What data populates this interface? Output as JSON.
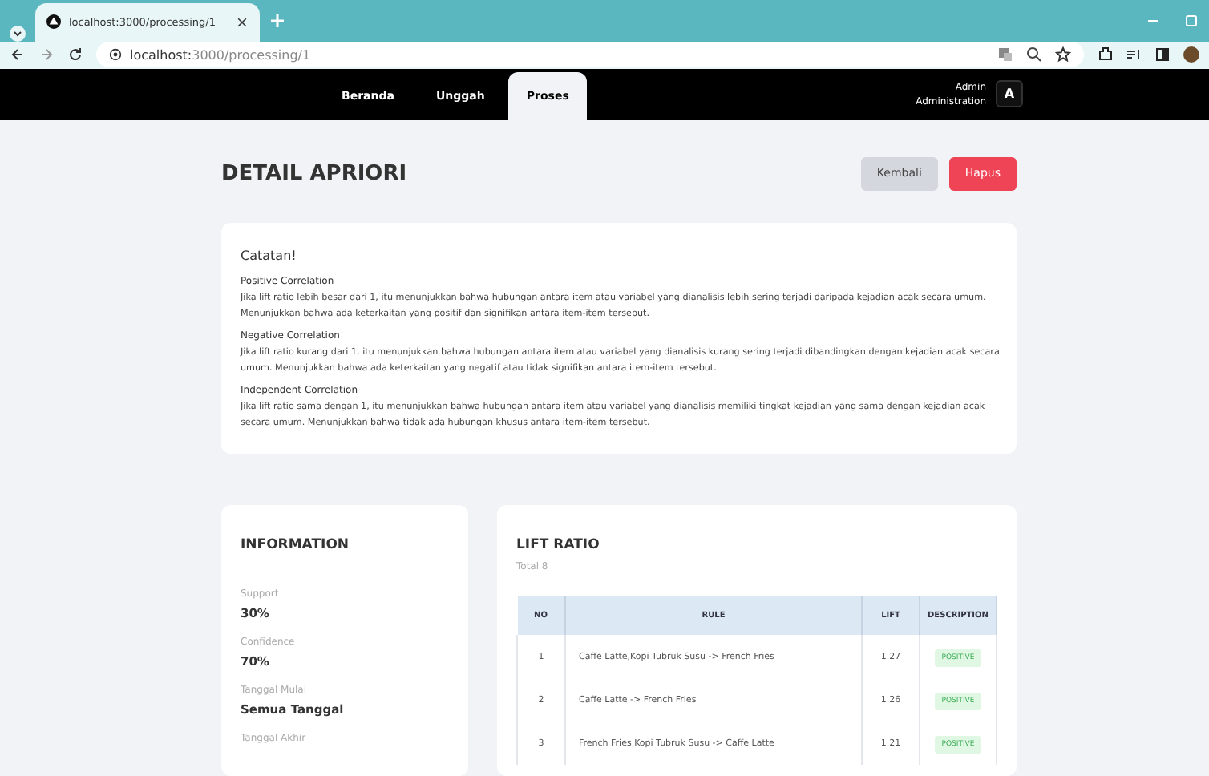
{
  "browser": {
    "tab_title": "localhost:3000/processing/1",
    "url_host": "localhost:",
    "url_path": "3000/processing/1"
  },
  "nav": {
    "items": [
      {
        "label": "Beranda",
        "selected": false
      },
      {
        "label": "Unggah",
        "selected": false
      },
      {
        "label": "Proses",
        "selected": true
      }
    ],
    "user_name": "Admin",
    "user_role": "Administration",
    "avatar": "A"
  },
  "page_title": "DETAIL APRIORI",
  "buttons": [
    {
      "label": "Kembali",
      "kind": "secondary"
    },
    {
      "label": "Hapus",
      "kind": "danger"
    }
  ],
  "notes": {
    "title": "Catatan!",
    "sections": [
      {
        "heading": "Positive Correlation",
        "text": "Jika lift ratio lebih besar dari 1, itu menunjukkan bahwa hubungan antara item atau variabel yang dianalisis lebih sering terjadi daripada kejadian acak secara umum. Menunjukkan bahwa ada keterkaitan yang positif dan signifikan antara item-item tersebut."
      },
      {
        "heading": "Negative Correlation",
        "text": "Jika lift ratio kurang dari 1, itu menunjukkan bahwa hubungan antara item atau variabel yang dianalisis kurang sering terjadi dibandingkan dengan kejadian acak secara umum. Menunjukkan bahwa ada keterkaitan yang negatif atau tidak signifikan antara item-item tersebut."
      },
      {
        "heading": "Independent Correlation",
        "text": "Jika lift ratio sama dengan 1, itu menunjukkan bahwa hubungan antara item atau variabel yang dianalisis memiliki tingkat kejadian yang sama dengan kejadian acak secara umum. Menunjukkan bahwa tidak ada hubungan khusus antara item-item tersebut."
      }
    ]
  },
  "information": {
    "title": "INFORMATION",
    "fields": [
      {
        "label": "Support",
        "value": "30%"
      },
      {
        "label": "Confidence",
        "value": "70%"
      },
      {
        "label": "Tanggal Mulai",
        "value": "Semua Tanggal"
      },
      {
        "label": "Tanggal Akhir"
      }
    ]
  },
  "lift_ratio": {
    "title": "LIFT RATIO",
    "total": "Total 8",
    "columns": [
      "NO",
      "RULE",
      "LIFT",
      "DESCRIPTION"
    ],
    "rows": [
      {
        "no": "1",
        "rule": "Caffe Latte,Kopi Tubruk Susu -> French Fries",
        "lift": "1.27",
        "description": "POSITIVE"
      },
      {
        "no": "2",
        "rule": "Caffe Latte -> French Fries",
        "lift": "1.26",
        "description": "POSITIVE"
      },
      {
        "no": "3",
        "rule": "French Fries,Kopi Tubruk Susu -> Caffe Latte",
        "lift": "1.21",
        "description": "POSITIVE"
      }
    ]
  }
}
